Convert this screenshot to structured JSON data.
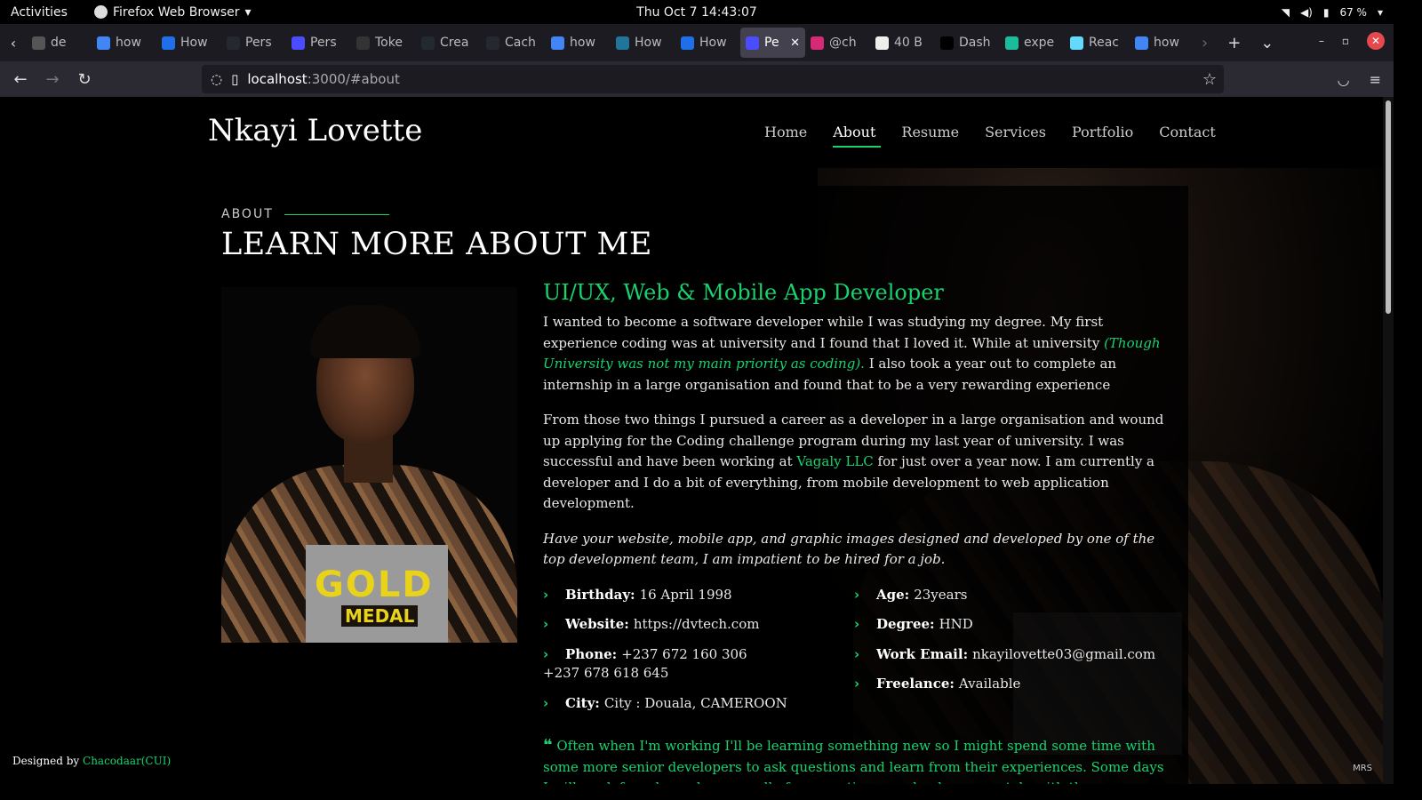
{
  "system": {
    "activities": "Activities",
    "app_name": "Firefox Web Browser",
    "clock": "Thu Oct 7  14:43:07",
    "battery": "67 %"
  },
  "browser": {
    "tabs": [
      {
        "label": "de",
        "color": "#555555"
      },
      {
        "label": "how",
        "color": "#4285f4"
      },
      {
        "label": "How",
        "color": "#1f6feb"
      },
      {
        "label": "Pers",
        "color": "#24292f"
      },
      {
        "label": "Pers",
        "color": "#4b4bff"
      },
      {
        "label": "Toke",
        "color": "#333333"
      },
      {
        "label": "Crea",
        "color": "#24292f"
      },
      {
        "label": "Cach",
        "color": "#24292f"
      },
      {
        "label": "how",
        "color": "#4285f4"
      },
      {
        "label": "How",
        "color": "#21759b"
      },
      {
        "label": "How",
        "color": "#1f6feb"
      },
      {
        "label": "Pe",
        "color": "#4b4bff"
      },
      {
        "label": "@ch",
        "color": "#d62976"
      },
      {
        "label": "40 B",
        "color": "#eeeeee"
      },
      {
        "label": "Dash",
        "color": "#000000"
      },
      {
        "label": "expe",
        "color": "#1abc9c"
      },
      {
        "label": "Reac",
        "color": "#61dafb"
      },
      {
        "label": "how",
        "color": "#4285f4"
      }
    ],
    "active_tab_index": 11,
    "url_host": "localhost",
    "url_path": ":3000/#about"
  },
  "site": {
    "brand": "Nkayi Lovette",
    "menu": [
      "Home",
      "About",
      "Resume",
      "Services",
      "Portfolio",
      "Contact"
    ],
    "active_menu": "About",
    "section_label": "ABOUT",
    "section_title": "LEARN MORE ABOUT ME",
    "role": "UI/UX, Web & Mobile App Developer",
    "para1_a": "I wanted to become a software developer while I was studying my degree. My first experience coding was at university and I found that I loved it. While at university ",
    "para1_green": "(Though University was not my main priority as coding).",
    "para1_b": " I also took a year out to complete an internship in a large organisation and found that to be a very rewarding experience",
    "para2_a": "From those two things I pursued a career as a developer in a large organisation and wound up applying for the Coding challenge program during my last year of university. I was successful and have been working at ",
    "para2_link": "Vagaly LLC",
    "para2_b": " for just over a year now. I am currently a developer and I do a bit of everything, from mobile development to web application development.",
    "tagline": "Have your website, mobile app, and graphic images designed and developed by one of the top development team, I am impatient to be hired for a job.",
    "facts_left": [
      {
        "label": "Birthday:",
        "value": "16 April 1998"
      },
      {
        "label": "Website:",
        "value": "https://dvtech.com"
      },
      {
        "label": "Phone:",
        "value": "+237 672 160 306"
      }
    ],
    "phone_extra": "+237 678 618 645",
    "city": {
      "label": "City:",
      "value": "City : Douala, CAMEROON"
    },
    "facts_right": [
      {
        "label": "Age:",
        "value": "23years"
      },
      {
        "label": "Degree:",
        "value": "HND"
      },
      {
        "label": "Work Email:",
        "value": "nkayilovette03@gmail.com"
      },
      {
        "label": "Freelance:",
        "value": "Available"
      }
    ],
    "quote": "Often when I'm working I'll be learning something new so I might spend some time with some more senior developers to ask questions and learn from their experiences. Some days I will work from home because all of my meetings can be done remotely with the technology provided by my work.",
    "footer_text": "Designed by ",
    "footer_link": "Chacodaar(CUI)",
    "watermark": "MRS",
    "portrait_text_gold": "GOLD",
    "portrait_text_medal": "MEDAL"
  },
  "colors": {
    "accent": "#18d26e"
  }
}
